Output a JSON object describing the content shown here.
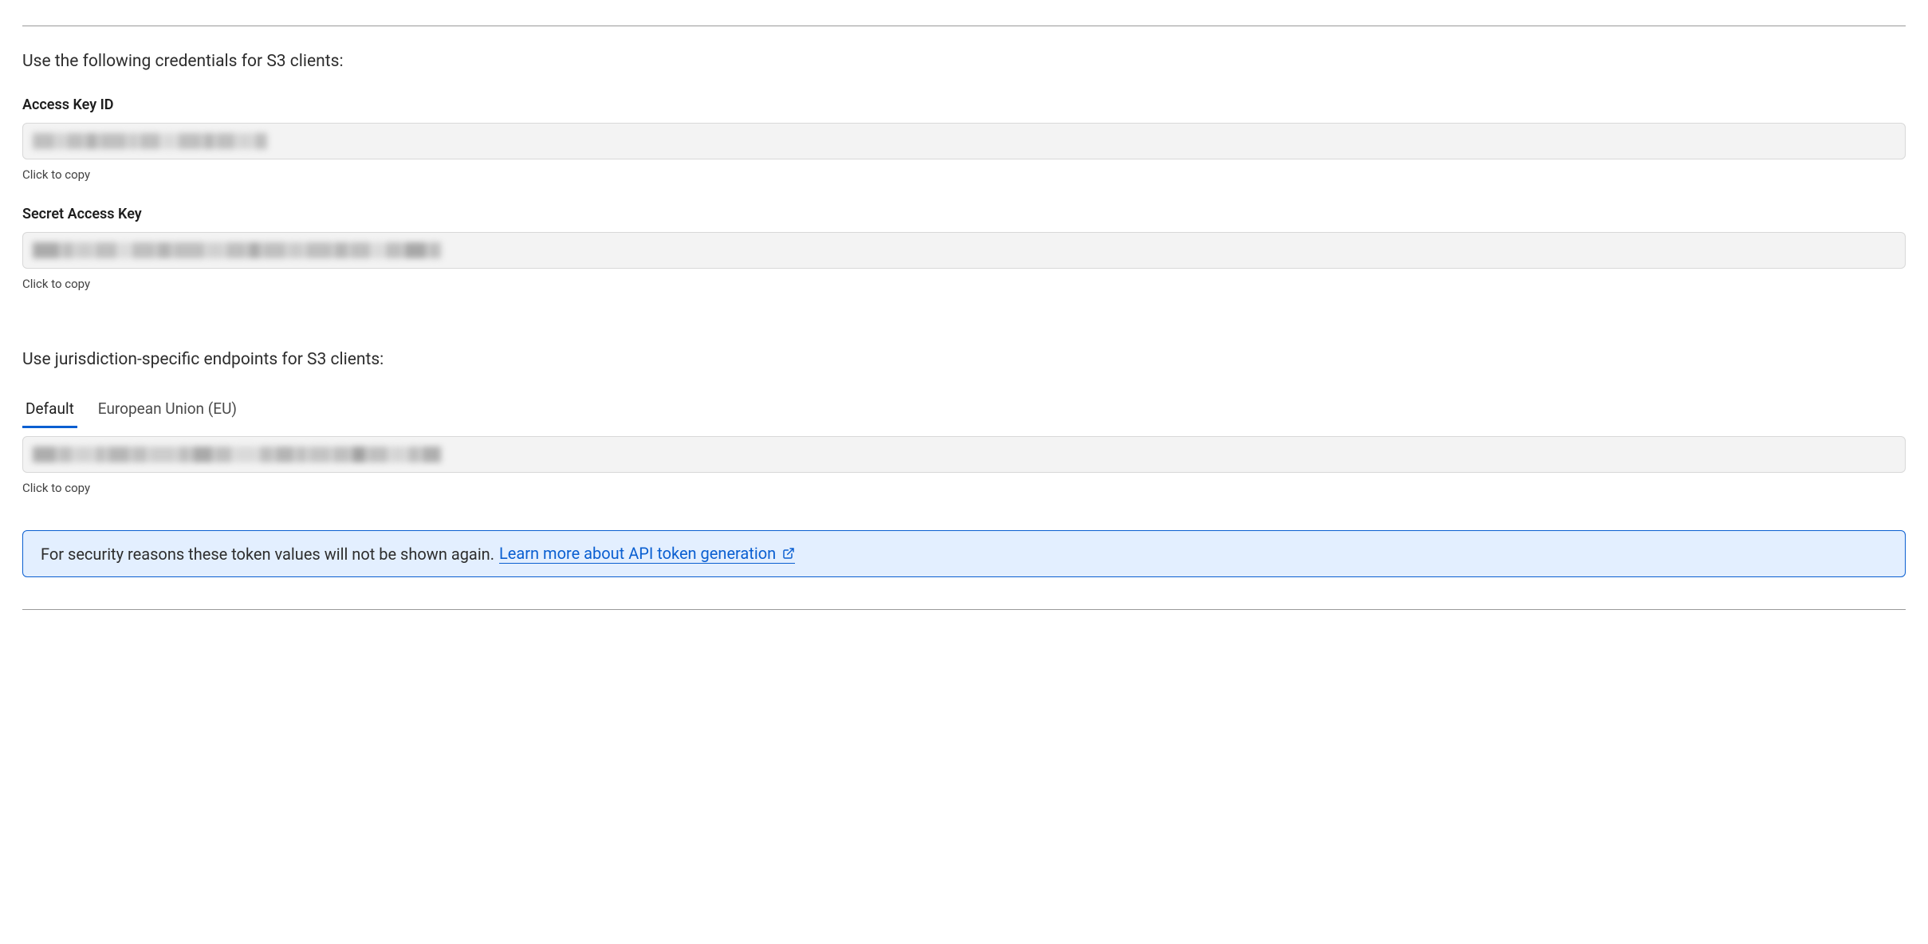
{
  "sections": {
    "credentials_intro": "Use the following credentials for S3 clients:",
    "endpoints_intro": "Use jurisdiction-specific endpoints for S3 clients:"
  },
  "fields": {
    "access_key": {
      "label": "Access Key ID",
      "helper": "Click to copy"
    },
    "secret_key": {
      "label": "Secret Access Key",
      "helper": "Click to copy"
    },
    "endpoint": {
      "helper": "Click to copy"
    }
  },
  "tabs": [
    {
      "label": "Default",
      "active": true
    },
    {
      "label": "European Union (EU)",
      "active": false
    }
  ],
  "notice": {
    "text": "For security reasons these token values will not be shown again.",
    "link_text": "Learn more about API token generation"
  }
}
